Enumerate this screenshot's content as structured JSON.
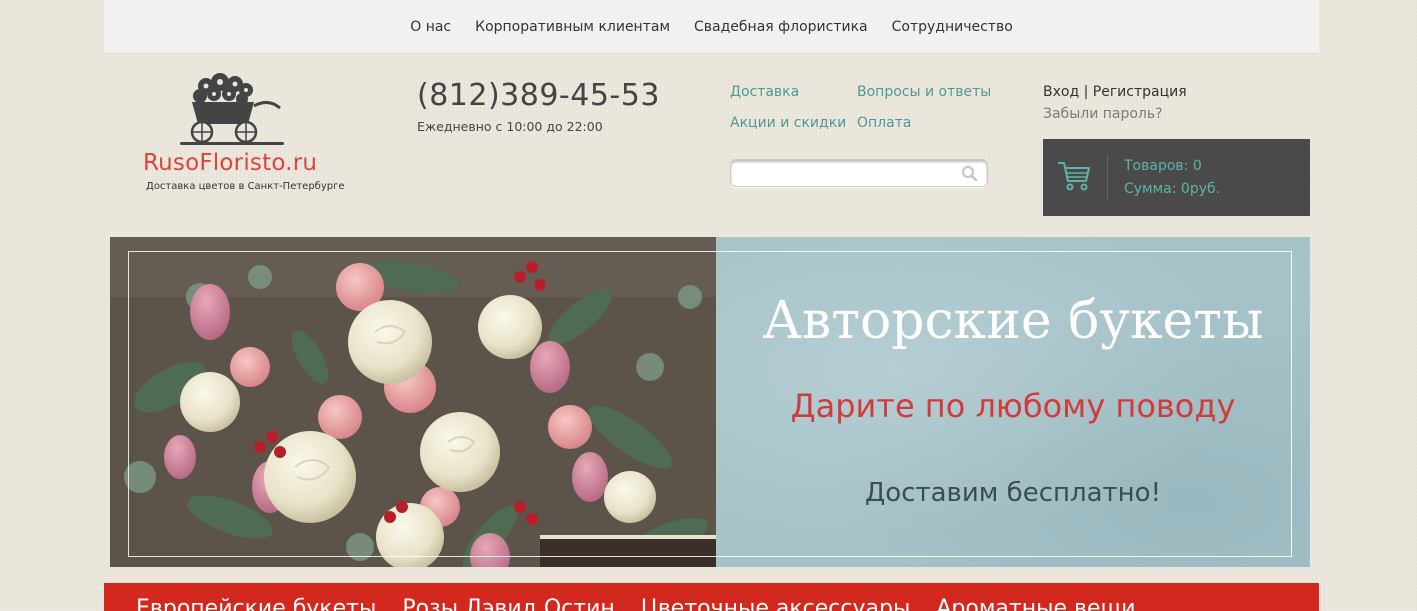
{
  "topnav": {
    "items": [
      "О нас",
      "Корпоративным клиентам",
      "Свадебная флористика",
      "Сотрудничество"
    ]
  },
  "logo": {
    "brand": "RusoFloristo.ru",
    "tagline": "Доставка цветов в Санкт-Петербурге"
  },
  "contact": {
    "phone": "(812)389-45-53",
    "hours": "Ежедневно с 10:00 до 22:00"
  },
  "infolinks": {
    "delivery": "Доставка",
    "faq": "Вопросы и ответы",
    "promotions": "Акции и скидки",
    "payment": "Оплата"
  },
  "search": {
    "value": "",
    "icon": "search-icon"
  },
  "auth": {
    "login": "Вход",
    "separator": "|",
    "register": "Регистрация",
    "forgot": "Забыли пароль?"
  },
  "cart": {
    "count_label": "Товаров: 0",
    "sum_label": "Сумма: 0руб.",
    "icon": "cart-icon"
  },
  "banner": {
    "headline": "Авторские букеты",
    "subheadline": "Дарите по любому поводу",
    "note": "Доставим бесплатно!"
  },
  "categories": {
    "items": [
      "Европейские букеты",
      "Розы Дэвид Остин",
      "Цветочные аксессуары",
      "Ароматные вещи"
    ]
  },
  "colors": {
    "accent_teal": "#4e9a8f",
    "brand_red": "#d9453a",
    "category_red": "#d3281e",
    "cart_bg": "#4a4a4a",
    "banner_panel": "#a5c3c9"
  }
}
